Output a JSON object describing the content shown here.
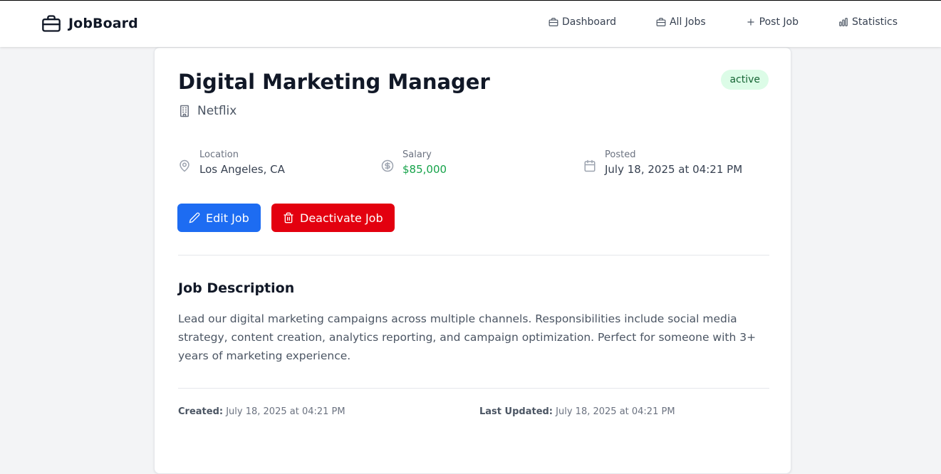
{
  "app": {
    "name": "JobBoard"
  },
  "nav": [
    {
      "label": "Dashboard",
      "icon": "briefcase-icon"
    },
    {
      "label": "All Jobs",
      "icon": "briefcase-icon"
    },
    {
      "label": "Post Job",
      "icon": "plus-icon"
    },
    {
      "label": "Statistics",
      "icon": "bar-chart-icon"
    }
  ],
  "job": {
    "title": "Digital Marketing Manager",
    "status": "active",
    "company": "Netflix",
    "location_label": "Location",
    "location": "Los Angeles, CA",
    "salary_label": "Salary",
    "salary": "$85,000",
    "posted_label": "Posted",
    "posted": "July 18, 2025 at 04:21 PM",
    "description_heading": "Job Description",
    "description": "Lead our digital marketing campaigns across multiple channels. Responsibilities include social media strategy, content creation, analytics reporting, and campaign optimization. Perfect for someone with 3+ years of marketing experience.",
    "created_label": "Created:",
    "created": "July 18, 2025 at 04:21 PM",
    "updated_label": "Last Updated:",
    "updated": "July 18, 2025 at 04:21 PM"
  },
  "actions": {
    "edit_label": "Edit Job",
    "deactivate_label": "Deactivate Job"
  },
  "colors": {
    "primary": "#1d6cf2",
    "danger": "#e3000f",
    "salary": "#16a34a",
    "badge_bg": "#dcfce7",
    "badge_text": "#166534"
  }
}
